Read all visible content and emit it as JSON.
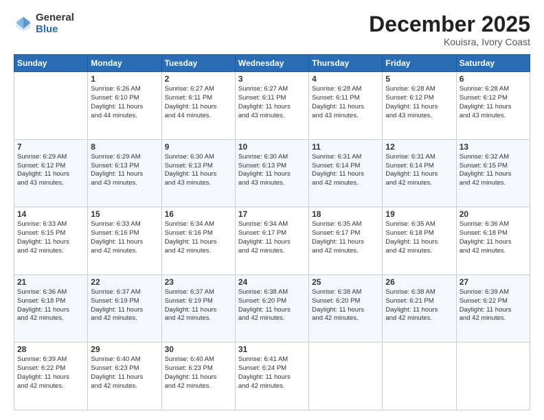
{
  "logo": {
    "general": "General",
    "blue": "Blue"
  },
  "header": {
    "month": "December 2025",
    "location": "Kouisra, Ivory Coast"
  },
  "weekdays": [
    "Sunday",
    "Monday",
    "Tuesday",
    "Wednesday",
    "Thursday",
    "Friday",
    "Saturday"
  ],
  "weeks": [
    [
      {
        "day": "",
        "info": ""
      },
      {
        "day": "1",
        "info": "Sunrise: 6:26 AM\nSunset: 6:10 PM\nDaylight: 11 hours\nand 44 minutes."
      },
      {
        "day": "2",
        "info": "Sunrise: 6:27 AM\nSunset: 6:11 PM\nDaylight: 11 hours\nand 44 minutes."
      },
      {
        "day": "3",
        "info": "Sunrise: 6:27 AM\nSunset: 6:11 PM\nDaylight: 11 hours\nand 43 minutes."
      },
      {
        "day": "4",
        "info": "Sunrise: 6:28 AM\nSunset: 6:11 PM\nDaylight: 11 hours\nand 43 minutes."
      },
      {
        "day": "5",
        "info": "Sunrise: 6:28 AM\nSunset: 6:12 PM\nDaylight: 11 hours\nand 43 minutes."
      },
      {
        "day": "6",
        "info": "Sunrise: 6:28 AM\nSunset: 6:12 PM\nDaylight: 11 hours\nand 43 minutes."
      }
    ],
    [
      {
        "day": "7",
        "info": "Sunrise: 6:29 AM\nSunset: 6:12 PM\nDaylight: 11 hours\nand 43 minutes."
      },
      {
        "day": "8",
        "info": "Sunrise: 6:29 AM\nSunset: 6:13 PM\nDaylight: 11 hours\nand 43 minutes."
      },
      {
        "day": "9",
        "info": "Sunrise: 6:30 AM\nSunset: 6:13 PM\nDaylight: 11 hours\nand 43 minutes."
      },
      {
        "day": "10",
        "info": "Sunrise: 6:30 AM\nSunset: 6:13 PM\nDaylight: 11 hours\nand 43 minutes."
      },
      {
        "day": "11",
        "info": "Sunrise: 6:31 AM\nSunset: 6:14 PM\nDaylight: 11 hours\nand 42 minutes."
      },
      {
        "day": "12",
        "info": "Sunrise: 6:31 AM\nSunset: 6:14 PM\nDaylight: 11 hours\nand 42 minutes."
      },
      {
        "day": "13",
        "info": "Sunrise: 6:32 AM\nSunset: 6:15 PM\nDaylight: 11 hours\nand 42 minutes."
      }
    ],
    [
      {
        "day": "14",
        "info": "Sunrise: 6:33 AM\nSunset: 6:15 PM\nDaylight: 11 hours\nand 42 minutes."
      },
      {
        "day": "15",
        "info": "Sunrise: 6:33 AM\nSunset: 6:16 PM\nDaylight: 11 hours\nand 42 minutes."
      },
      {
        "day": "16",
        "info": "Sunrise: 6:34 AM\nSunset: 6:16 PM\nDaylight: 11 hours\nand 42 minutes."
      },
      {
        "day": "17",
        "info": "Sunrise: 6:34 AM\nSunset: 6:17 PM\nDaylight: 11 hours\nand 42 minutes."
      },
      {
        "day": "18",
        "info": "Sunrise: 6:35 AM\nSunset: 6:17 PM\nDaylight: 11 hours\nand 42 minutes."
      },
      {
        "day": "19",
        "info": "Sunrise: 6:35 AM\nSunset: 6:18 PM\nDaylight: 11 hours\nand 42 minutes."
      },
      {
        "day": "20",
        "info": "Sunrise: 6:36 AM\nSunset: 6:18 PM\nDaylight: 11 hours\nand 42 minutes."
      }
    ],
    [
      {
        "day": "21",
        "info": "Sunrise: 6:36 AM\nSunset: 6:18 PM\nDaylight: 11 hours\nand 42 minutes."
      },
      {
        "day": "22",
        "info": "Sunrise: 6:37 AM\nSunset: 6:19 PM\nDaylight: 11 hours\nand 42 minutes."
      },
      {
        "day": "23",
        "info": "Sunrise: 6:37 AM\nSunset: 6:19 PM\nDaylight: 11 hours\nand 42 minutes."
      },
      {
        "day": "24",
        "info": "Sunrise: 6:38 AM\nSunset: 6:20 PM\nDaylight: 11 hours\nand 42 minutes."
      },
      {
        "day": "25",
        "info": "Sunrise: 6:38 AM\nSunset: 6:20 PM\nDaylight: 11 hours\nand 42 minutes."
      },
      {
        "day": "26",
        "info": "Sunrise: 6:38 AM\nSunset: 6:21 PM\nDaylight: 11 hours\nand 42 minutes."
      },
      {
        "day": "27",
        "info": "Sunrise: 6:39 AM\nSunset: 6:22 PM\nDaylight: 11 hours\nand 42 minutes."
      }
    ],
    [
      {
        "day": "28",
        "info": "Sunrise: 6:39 AM\nSunset: 6:22 PM\nDaylight: 11 hours\nand 42 minutes."
      },
      {
        "day": "29",
        "info": "Sunrise: 6:40 AM\nSunset: 6:23 PM\nDaylight: 11 hours\nand 42 minutes."
      },
      {
        "day": "30",
        "info": "Sunrise: 6:40 AM\nSunset: 6:23 PM\nDaylight: 11 hours\nand 42 minutes."
      },
      {
        "day": "31",
        "info": "Sunrise: 6:41 AM\nSunset: 6:24 PM\nDaylight: 11 hours\nand 42 minutes."
      },
      {
        "day": "",
        "info": ""
      },
      {
        "day": "",
        "info": ""
      },
      {
        "day": "",
        "info": ""
      }
    ]
  ]
}
